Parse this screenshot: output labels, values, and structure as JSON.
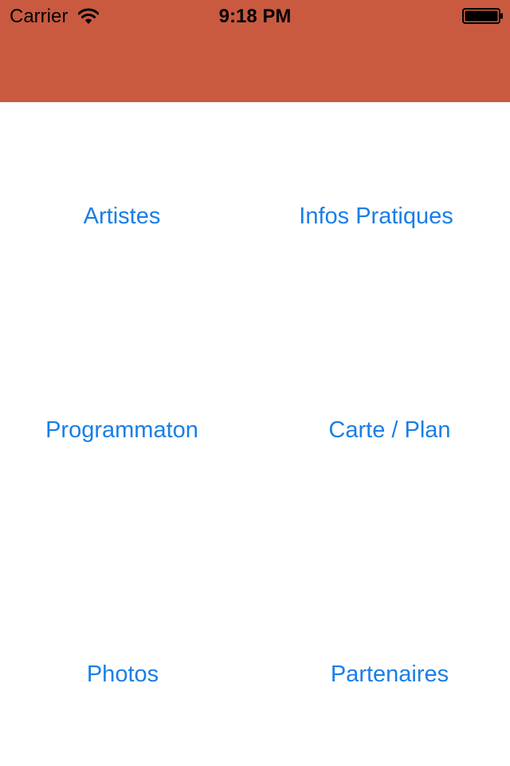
{
  "status_bar": {
    "carrier": "Carrier",
    "time": "9:18 PM",
    "wifi_icon": "wifi-icon",
    "battery_icon": "battery-icon"
  },
  "colors": {
    "header_background": "#c95a40",
    "link": "#1a7ee6",
    "background": "#ffffff"
  },
  "menu": {
    "items": [
      {
        "label": "Artistes"
      },
      {
        "label": "Infos Pratiques"
      },
      {
        "label": "Programmaton"
      },
      {
        "label": "Carte / Plan"
      },
      {
        "label": "Photos"
      },
      {
        "label": "Partenaires"
      }
    ]
  }
}
